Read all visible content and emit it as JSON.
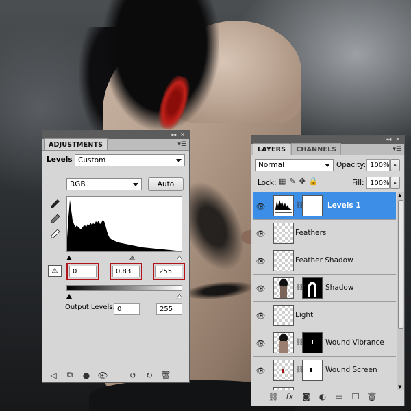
{
  "adjustments": {
    "tab": "ADJUSTMENTS",
    "type_label": "Levels",
    "preset": "Custom",
    "channel": "RGB",
    "auto_label": "Auto",
    "input_levels": {
      "black": "0",
      "gamma": "0.83",
      "white": "255"
    },
    "output_label": "Output Levels:",
    "output_levels": {
      "black": "0",
      "white": "255"
    }
  },
  "layers_panel": {
    "tabs": [
      {
        "label": "LAYERS"
      },
      {
        "label": "CHANNELS"
      }
    ],
    "blend_mode": "Normal",
    "opacity_label": "Opacity:",
    "opacity": "100%",
    "lock_label": "Lock:",
    "fill_label": "Fill:",
    "fill": "100%",
    "layers": [
      {
        "name": "Levels 1",
        "selected": true,
        "thumb": "levels-adjustment",
        "mask": "white"
      },
      {
        "name": "Feathers",
        "selected": false,
        "thumb": "transparent"
      },
      {
        "name": "Feather Shadow",
        "selected": false,
        "thumb": "transparent"
      },
      {
        "name": "Shadow",
        "selected": false,
        "thumb": "figure",
        "mask": "shadow"
      },
      {
        "name": "Light",
        "selected": false,
        "thumb": "transparent"
      },
      {
        "name": "Wound Vibrance",
        "selected": false,
        "thumb": "figure",
        "mask": "black"
      },
      {
        "name": "Wound Screen",
        "selected": false,
        "thumb": "transparent",
        "mask": "white-dot"
      }
    ]
  },
  "colors": {
    "selected": "#3d8ee6",
    "highlight_box": "#b2121a",
    "panel_bg": "#d6d6d6"
  }
}
